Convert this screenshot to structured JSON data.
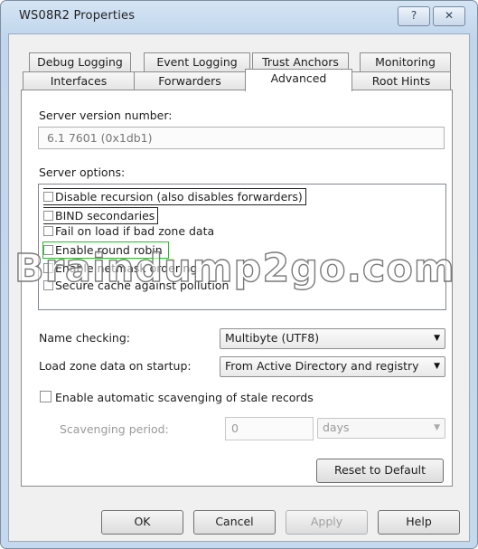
{
  "window": {
    "title": "WS08R2 Properties",
    "help_glyph": "?",
    "close_glyph": "✕"
  },
  "tabs_row1": [
    "Debug Logging",
    "Event Logging",
    "Trust Anchors",
    "Monitoring"
  ],
  "tabs_row2": [
    "Interfaces",
    "Forwarders",
    "Advanced",
    "Root Hints"
  ],
  "active_tab": "Advanced",
  "advanced": {
    "server_version_label": "Server version number:",
    "server_version_value": "6.1 7601 (0x1db1)",
    "server_options_label": "Server options:",
    "options": [
      {
        "label": "Disable recursion (also disables forwarders)",
        "checked": false
      },
      {
        "label": "BIND secondaries",
        "checked": false
      },
      {
        "label": "Fail on load if bad zone data",
        "checked": false
      },
      {
        "label": "Enable round robin",
        "checked": false
      },
      {
        "label": "Enable netmask ordering",
        "checked": false
      },
      {
        "label": "Secure cache against pollution",
        "checked": false
      }
    ],
    "name_checking_label": "Name checking:",
    "name_checking_value": "Multibyte (UTF8)",
    "load_zone_label": "Load zone data on startup:",
    "load_zone_value": "From Active Directory and registry",
    "scavenging_checkbox_label": "Enable automatic scavenging of stale records",
    "scavenging_checked": false,
    "scavenging_period_label": "Scavenging period:",
    "scavenging_period_value": "0",
    "scavenging_unit": "days",
    "reset_button": "Reset to Default"
  },
  "footer": {
    "ok": "OK",
    "cancel": "Cancel",
    "apply": "Apply",
    "help": "Help"
  },
  "watermark": "Braindump2go.com",
  "colors": {
    "highlight_border": "#22c022",
    "title_bar": "#c8dbef"
  }
}
